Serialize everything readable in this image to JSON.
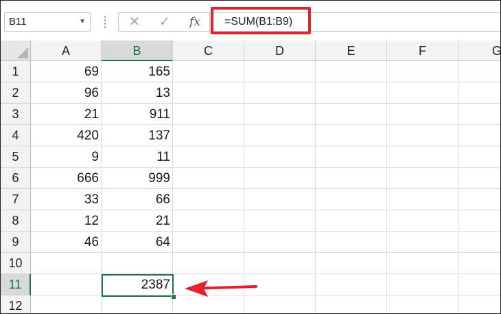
{
  "name_box": {
    "value": "B11"
  },
  "formula_bar": {
    "cancel_glyph": "✕",
    "enter_glyph": "✓",
    "fx_label": "fx",
    "formula": "=SUM(B1:B9)"
  },
  "columns": [
    "A",
    "B",
    "C",
    "D",
    "E",
    "F",
    "G"
  ],
  "rows": [
    {
      "n": "1",
      "A": "69",
      "B": "165"
    },
    {
      "n": "2",
      "A": "96",
      "B": "13"
    },
    {
      "n": "3",
      "A": "21",
      "B": "911"
    },
    {
      "n": "4",
      "A": "420",
      "B": "137"
    },
    {
      "n": "5",
      "A": "9",
      "B": "11"
    },
    {
      "n": "6",
      "A": "666",
      "B": "999"
    },
    {
      "n": "7",
      "A": "33",
      "B": "66"
    },
    {
      "n": "8",
      "A": "12",
      "B": "21"
    },
    {
      "n": "9",
      "A": "46",
      "B": "64"
    },
    {
      "n": "10",
      "A": "",
      "B": ""
    },
    {
      "n": "11",
      "A": "",
      "B": "2387"
    },
    {
      "n": "12",
      "A": "",
      "B": ""
    }
  ],
  "selection": {
    "active_cell": "B11",
    "selected_column": "B",
    "selected_row": "11"
  },
  "colors": {
    "highlight": "#e0232e",
    "excel_green": "#217346"
  }
}
